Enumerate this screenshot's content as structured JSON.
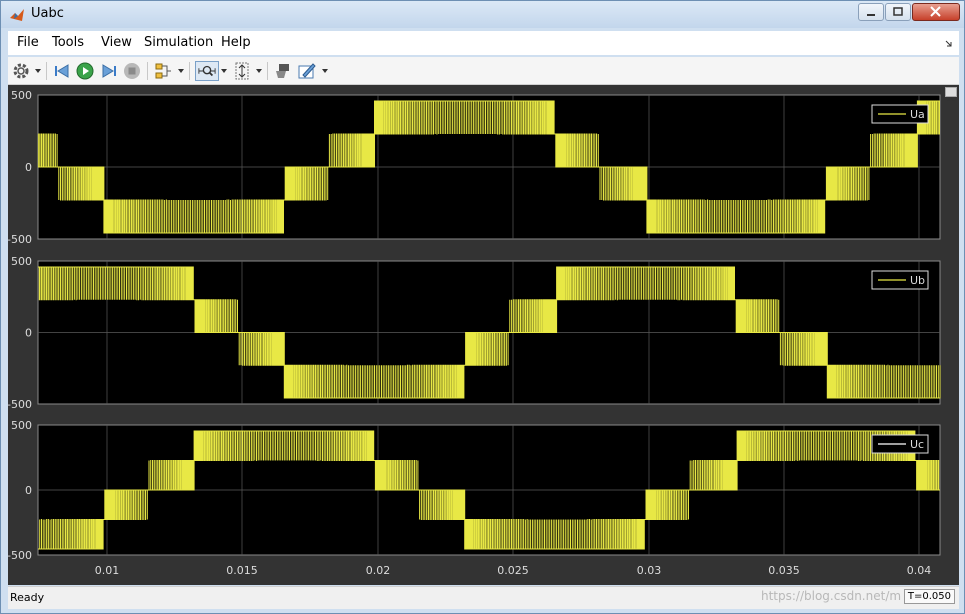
{
  "window": {
    "title": "Uabc"
  },
  "menu": [
    "File",
    "Tools",
    "View",
    "Simulation",
    "Help"
  ],
  "toolbar": {
    "icons": [
      "gear-icon",
      "step-back-icon",
      "run-icon",
      "step-forward-icon",
      "stop-icon",
      "signal-select-icon",
      "zoom-time-icon",
      "autoscale-y-icon",
      "highlight-block-icon",
      "style-icon"
    ]
  },
  "plots": [
    {
      "legend": "Ua",
      "yticks": [
        "500",
        "0",
        "-500"
      ]
    },
    {
      "legend": "Ub",
      "yticks": [
        "500",
        "0",
        "-500"
      ]
    },
    {
      "legend": "Uc",
      "yticks": [
        "500",
        "0",
        "-500"
      ]
    }
  ],
  "xaxis": {
    "ticks": [
      "0.01",
      "0.015",
      "0.02",
      "0.025",
      "0.03",
      "0.035",
      "0.04"
    ]
  },
  "status": {
    "left": "Ready",
    "right": "T=0.050"
  },
  "watermark": "https://blog.csdn.net/m",
  "colors": {
    "trace": "#e8e845",
    "axes_bg": "#000000",
    "figure_bg": "#333333",
    "grid": "#5a5a5a"
  }
}
